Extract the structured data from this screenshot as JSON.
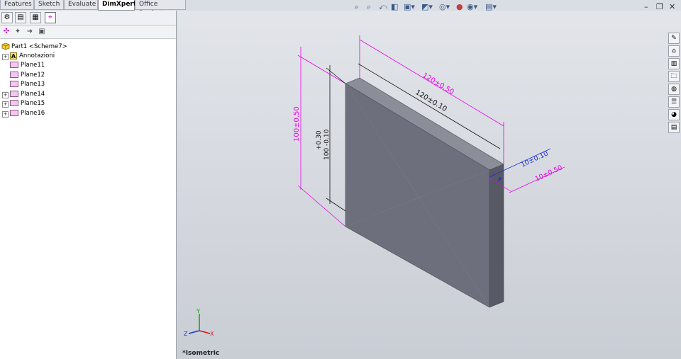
{
  "tabs": [
    {
      "label": "Features",
      "active": false
    },
    {
      "label": "Sketch",
      "active": false
    },
    {
      "label": "Evaluate",
      "active": false
    },
    {
      "label": "DimXpert",
      "active": true
    },
    {
      "label": "Office Products",
      "active": false
    }
  ],
  "tree": {
    "root": "Part1 <Scheme7>",
    "annotations": "Annotazioni",
    "planes": [
      "Plane11",
      "Plane12",
      "Plane13",
      "Plane14",
      "Plane15",
      "Plane16"
    ]
  },
  "viewport": {
    "view_label": "*Isometric",
    "dims": {
      "width_outer": "120±0.50",
      "width_inner": "120±0.10",
      "height_outer": "100±0.50",
      "height_tol_upper": "+0.30",
      "height_tol_main": "100 -0.10",
      "thick_inner": "10±0.10",
      "thick_outer": "10±0.50"
    },
    "axes": {
      "x": "X",
      "y": "Y",
      "z": "Z"
    }
  },
  "colors": {
    "magenta": "#e600e6",
    "blue": "#1f2fd6",
    "part_face": "#6c6f7b",
    "part_top": "#8a8d98"
  }
}
